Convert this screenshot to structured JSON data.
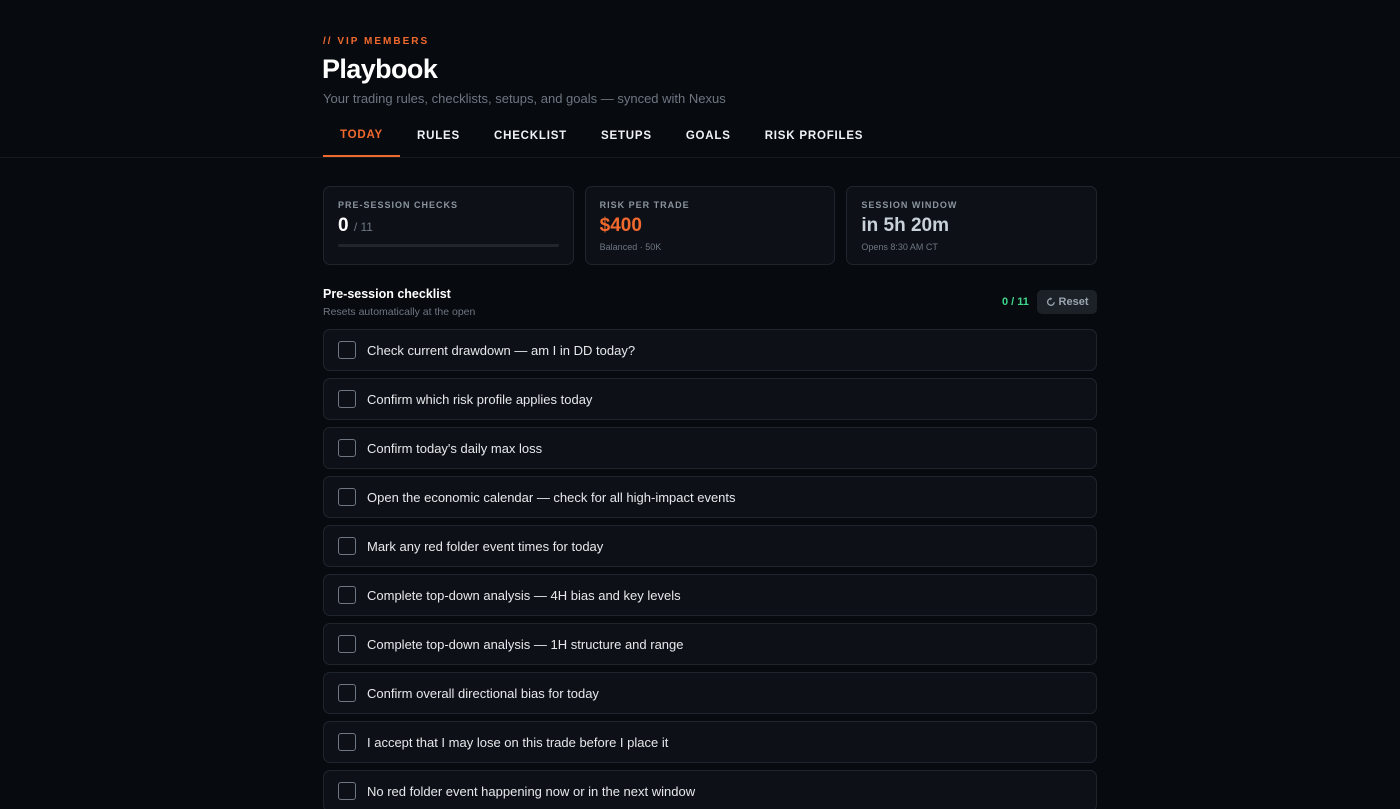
{
  "header": {
    "eyebrow": "// VIP MEMBERS",
    "title": "Playbook",
    "subtitle": "Your trading rules, checklists, setups, and goals — synced with Nexus"
  },
  "tabs": [
    {
      "label": "TODAY",
      "active": true
    },
    {
      "label": "RULES",
      "active": false
    },
    {
      "label": "CHECKLIST",
      "active": false
    },
    {
      "label": "SETUPS",
      "active": false
    },
    {
      "label": "GOALS",
      "active": false
    },
    {
      "label": "RISK PROFILES",
      "active": false
    }
  ],
  "stats": {
    "pre_session": {
      "label": "PRE-SESSION CHECKS",
      "value": "0",
      "denominator": "/ 11",
      "progress": 0
    },
    "risk": {
      "label": "RISK PER TRADE",
      "value": "$400",
      "sub": "Balanced · 50K"
    },
    "session": {
      "label": "SESSION WINDOW",
      "value": "in 5h 20m",
      "sub": "Opens 8:30 AM CT"
    }
  },
  "checklist": {
    "title": "Pre-session checklist",
    "subtitle": "Resets automatically at the open",
    "count": "0 / 11",
    "reset_label": "Reset",
    "items": [
      "Check current drawdown — am I in DD today?",
      "Confirm which risk profile applies today",
      "Confirm today's daily max loss",
      "Open the economic calendar — check for all high-impact events",
      "Mark any red folder event times for today",
      "Complete top-down analysis — 4H bias and key levels",
      "Complete top-down analysis — 1H structure and range",
      "Confirm overall directional bias for today",
      "I accept that I may lose on this trade before I place it",
      "No red folder event happening now or in the next window"
    ]
  },
  "colors": {
    "accent": "#f2692e",
    "success": "#3fd68c",
    "background": "#070a0f",
    "card": "#0d1117"
  }
}
